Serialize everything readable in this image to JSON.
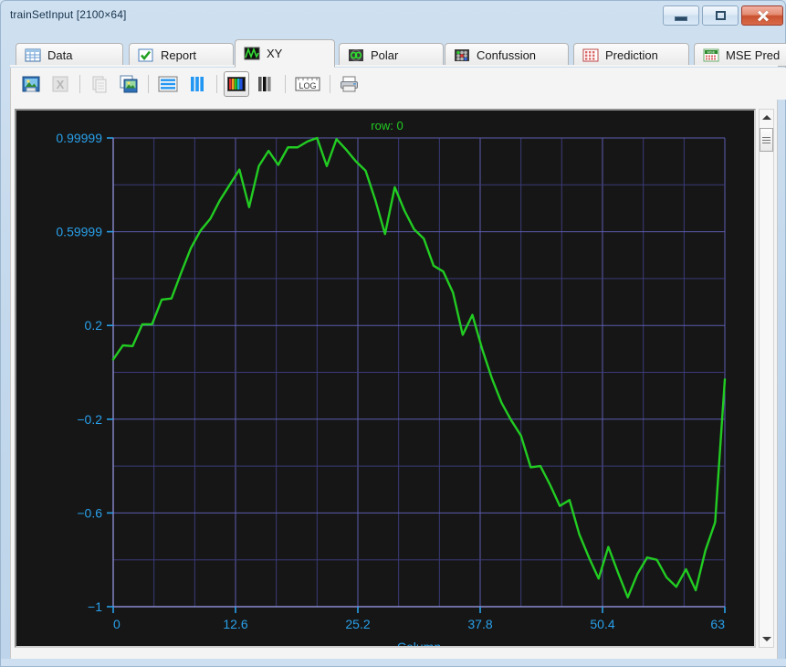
{
  "window": {
    "title": "trainSetInput [2100×64]",
    "buttons": {
      "minimize": "Minimize",
      "maximize": "Maximize",
      "close": "Close"
    }
  },
  "tabs": [
    {
      "label": "Data",
      "icon": "table-icon",
      "active": false
    },
    {
      "label": "Report",
      "icon": "checkmark-icon",
      "active": false
    },
    {
      "label": "XY",
      "icon": "waveform-icon",
      "active": true
    },
    {
      "label": "Polar",
      "icon": "polar-icon",
      "active": false
    },
    {
      "label": "Confussion",
      "icon": "confusion-icon",
      "active": false
    },
    {
      "label": "Prediction",
      "icon": "prediction-icon",
      "active": false
    },
    {
      "label": "MSE Pred",
      "icon": "mse-icon",
      "active": false
    }
  ],
  "toolbar": {
    "buttons": [
      {
        "name": "save-image-button",
        "icon": "save-image-icon",
        "enabled": true
      },
      {
        "name": "export-excel-button",
        "icon": "excel-icon",
        "enabled": false
      },
      {
        "name": "copy-button",
        "icon": "copy-icon",
        "enabled": false
      },
      {
        "name": "copy-image-button",
        "icon": "copy-image-icon",
        "enabled": true
      },
      {
        "name": "horizontal-lines-button",
        "icon": "horizontal-lines-icon",
        "enabled": true
      },
      {
        "name": "vertical-lines-button",
        "icon": "vertical-lines-icon",
        "enabled": true
      },
      {
        "name": "color-bars-button",
        "icon": "color-bars-icon",
        "enabled": true
      },
      {
        "name": "gray-bars-button",
        "icon": "gray-bars-icon",
        "enabled": true
      },
      {
        "name": "log-scale-button",
        "icon": "log-icon",
        "label": "LOG",
        "enabled": true
      },
      {
        "name": "print-button",
        "icon": "printer-icon",
        "enabled": true
      }
    ]
  },
  "scrollbar": {
    "up_arrow": "scroll-up",
    "down_arrow": "scroll-down",
    "thumb": "scroll-thumb"
  },
  "colors": {
    "plot_background": "#161616",
    "grid_minor": "#3a3a7a",
    "grid_major": "#5c5cb0",
    "axis": "#8a8ad0",
    "tick_label": "#29a0ea",
    "series": "#22cc22",
    "title": "#22cc22",
    "window_accent": "#cddff0",
    "close_button": "#c9512f"
  },
  "chart_data": {
    "type": "line",
    "title": "row: 0",
    "xlabel": "Column",
    "ylabel": "",
    "xlim": [
      0,
      63
    ],
    "ylim": [
      -1,
      0.99999
    ],
    "xticks": [
      0,
      12.6,
      25.2,
      37.8,
      50.4,
      63
    ],
    "xtick_labels": [
      "0",
      "12.6",
      "25.2",
      "37.8",
      "50.4",
      "63"
    ],
    "yticks": [
      0.99999,
      0.59999,
      0.2,
      -0.2,
      -0.6,
      -1
    ],
    "ytick_labels": [
      "0.99999",
      "0.59999",
      "0.2",
      "-0.2",
      "-0.6",
      "-1"
    ],
    "grid": true,
    "minor_grid": true,
    "legend": null,
    "series": [
      {
        "name": "row 0",
        "color": "#22cc22",
        "x": [
          0,
          1,
          2,
          3,
          4,
          5,
          6,
          7,
          8,
          9,
          10,
          11,
          12,
          13,
          14,
          15,
          16,
          17,
          18,
          19,
          20,
          21,
          22,
          23,
          24,
          25,
          26,
          27,
          28,
          29,
          30,
          31,
          32,
          33,
          34,
          35,
          36,
          37,
          38,
          39,
          40,
          41,
          42,
          43,
          44,
          45,
          46,
          47,
          48,
          49,
          50,
          51,
          52,
          53,
          54,
          55,
          56,
          57,
          58,
          59,
          60,
          61,
          62,
          63
        ],
        "values": [
          0.055,
          0.115,
          0.112,
          0.205,
          0.205,
          0.31,
          0.315,
          0.425,
          0.53,
          0.605,
          0.655,
          0.735,
          0.8,
          0.865,
          0.705,
          0.88,
          0.945,
          0.885,
          0.96,
          0.96,
          0.985,
          1.0,
          0.88,
          0.995,
          0.95,
          0.9,
          0.86,
          0.735,
          0.59,
          0.79,
          0.69,
          0.61,
          0.57,
          0.455,
          0.43,
          0.34,
          0.16,
          0.245,
          0.1,
          -0.025,
          -0.13,
          -0.205,
          -0.27,
          -0.405,
          -0.4,
          -0.48,
          -0.57,
          -0.545,
          -0.69,
          -0.79,
          -0.88,
          -0.745,
          -0.855,
          -0.96,
          -0.86,
          -0.79,
          -0.8,
          -0.875,
          -0.915,
          -0.84,
          -0.93,
          -0.76,
          -0.64,
          -0.03
        ]
      }
    ]
  }
}
